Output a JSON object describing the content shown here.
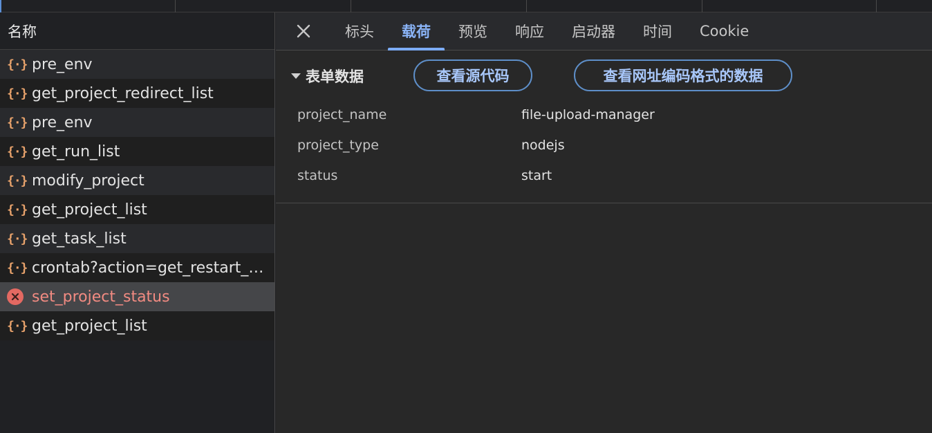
{
  "left_pane": {
    "header": "名称",
    "requests": [
      {
        "name": "pre_env",
        "status": "ok"
      },
      {
        "name": "get_project_redirect_list",
        "status": "ok"
      },
      {
        "name": "pre_env",
        "status": "ok"
      },
      {
        "name": "get_run_list",
        "status": "ok"
      },
      {
        "name": "modify_project",
        "status": "ok"
      },
      {
        "name": "get_project_list",
        "status": "ok"
      },
      {
        "name": "get_task_list",
        "status": "ok"
      },
      {
        "name": "crontab?action=get_restart_…",
        "status": "ok"
      },
      {
        "name": "set_project_status",
        "status": "error",
        "selected": true
      },
      {
        "name": "get_project_list",
        "status": "ok"
      }
    ],
    "icons": {
      "json": "{·}",
      "error": "error-circle-icon"
    }
  },
  "tabs": {
    "items": [
      "标头",
      "载荷",
      "预览",
      "响应",
      "启动器",
      "时间",
      "Cookie"
    ],
    "active": "载荷"
  },
  "payload": {
    "section_title": "表单数据",
    "view_source_button": "查看源代码",
    "view_url_encoded_button": "查看网址编码格式的数据",
    "fields": [
      {
        "key": "project_name",
        "value": "file-upload-manager"
      },
      {
        "key": "project_type",
        "value": "nodejs"
      },
      {
        "key": "status",
        "value": "start"
      }
    ]
  },
  "colors": {
    "accent": "#8ab4f8",
    "error": "#f28b82",
    "json_icon": "#e9a36c"
  }
}
